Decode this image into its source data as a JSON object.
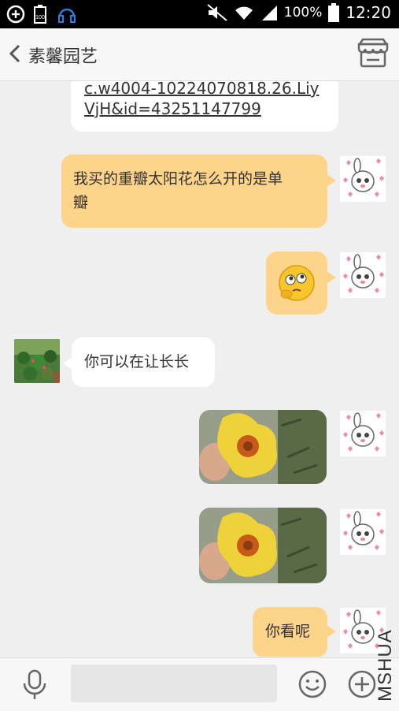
{
  "status_bar": {
    "battery_percent": "100%",
    "time": "12:20",
    "left_badge": "100"
  },
  "header": {
    "title": "素馨园艺",
    "back_icon": "chevron-left-icon",
    "right_icon": "store-icon"
  },
  "messages": [
    {
      "from": "other",
      "type": "link",
      "lines": [
        "c.w4004-10224070818.26.Liy",
        "VjH&id=43251147799"
      ]
    },
    {
      "from": "me",
      "type": "text",
      "lines": [
        "我买的重瓣太阳花怎么开的是单",
        "瓣"
      ]
    },
    {
      "from": "me",
      "type": "sticker",
      "sticker": "thinking-face"
    },
    {
      "from": "other",
      "type": "text",
      "lines": [
        "你可以在让长长"
      ]
    },
    {
      "from": "me",
      "type": "image",
      "image": "yellow-flower-photo"
    },
    {
      "from": "me",
      "type": "image",
      "image": "yellow-flower-photo"
    },
    {
      "from": "me",
      "type": "text",
      "lines": [
        "你看呢"
      ]
    }
  ],
  "watermark": "MSHUA",
  "colors": {
    "outgoing_bubble": "#fed38a",
    "incoming_bubble": "#ffffff",
    "background": "#efefef"
  }
}
